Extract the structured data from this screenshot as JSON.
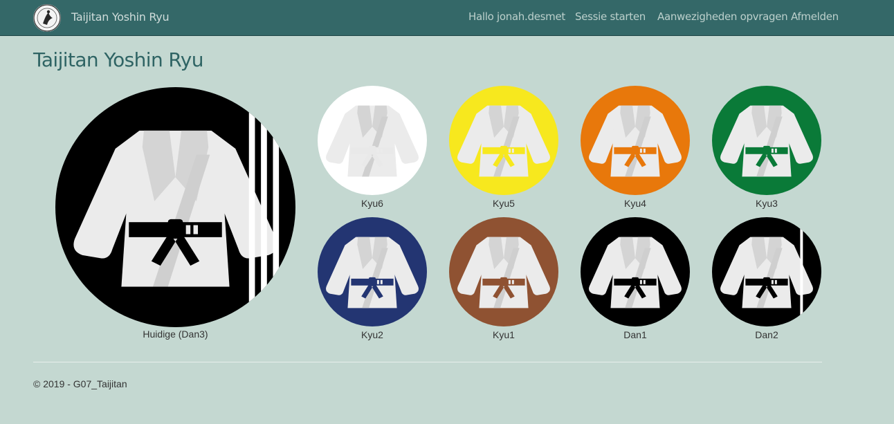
{
  "navbar": {
    "brand": "Taijitan Yoshin Ryu",
    "links": [
      "Hallo jonah.desmet",
      "Sessie starten",
      "Aanwezigheden opvragen",
      "Afmelden"
    ]
  },
  "page": {
    "title": "Taijitan Yoshin Ryu"
  },
  "current_rank": {
    "label": "Huidige (Dan3)",
    "circle_color": "#000000",
    "belt_color": "#000000"
  },
  "ranks": [
    {
      "label": "Kyu6",
      "circle_color": "#ffffff",
      "belt_color": "#ffffff"
    },
    {
      "label": "Kyu5",
      "circle_color": "#f7e81e",
      "belt_color": "#f7e81e"
    },
    {
      "label": "Kyu4",
      "circle_color": "#e8780b",
      "belt_color": "#e8780b"
    },
    {
      "label": "Kyu3",
      "circle_color": "#0a7a38",
      "belt_color": "#0a7a38"
    },
    {
      "label": "Kyu2",
      "circle_color": "#233572",
      "belt_color": "#233572"
    },
    {
      "label": "Kyu1",
      "circle_color": "#8f5232",
      "belt_color": "#8f5232"
    },
    {
      "label": "Dan1",
      "circle_color": "#000000",
      "belt_color": "#000000"
    },
    {
      "label": "Dan2",
      "circle_color": "#000000",
      "belt_color": "#000000"
    }
  ],
  "footer": {
    "text": "© 2019 - G07_Taijitan"
  }
}
